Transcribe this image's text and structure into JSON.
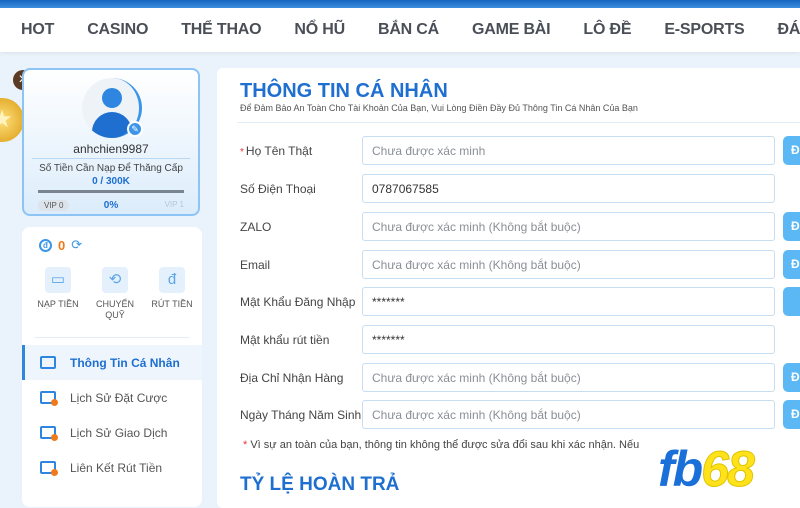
{
  "nav": {
    "items": [
      "HOT",
      "CASINO",
      "THỂ THAO",
      "NỔ HŨ",
      "BẮN CÁ",
      "GAME BÀI",
      "LÔ ĐỀ",
      "E-SPORTS",
      "ĐÁ G"
    ]
  },
  "profile": {
    "username": "anhchien9987",
    "need_label": "Số Tiền Cần Nạp Để Thăng Cấp",
    "amount": "0 / 300K",
    "progress_percent": 0,
    "percent_text": "0%",
    "vip_current": "VIP 0",
    "vip_next": "VIP 1"
  },
  "wallet": {
    "balance": "0",
    "actions": [
      {
        "label": "NẠP TIỀN",
        "icon": "wallet-icon"
      },
      {
        "label": "CHUYỂN QUỸ",
        "icon": "transfer-icon"
      },
      {
        "label": "RÚT TIỀN",
        "icon": "money-bag-icon"
      }
    ]
  },
  "menu": [
    {
      "label": "Thông Tin Cá Nhân",
      "active": true
    },
    {
      "label": "Lịch Sử Đặt Cược"
    },
    {
      "label": "Lịch Sử Giao Dịch"
    },
    {
      "label": "Liên Kết Rút Tiền"
    }
  ],
  "form": {
    "title": "THÔNG TIN CÁ NHÂN",
    "subtitle": "Để Đảm Bảo An Toàn Cho Tài Khoản Của Bạn, Vui Lòng Điền Đầy Đủ Thông Tin Cá Nhân Của Bạn",
    "fields": [
      {
        "label": "Họ Tên Thật",
        "required": true,
        "value": "",
        "placeholder": "Chưa được xác minh",
        "button": "Đ"
      },
      {
        "label": "Số Điện Thoại",
        "value": "0787067585",
        "placeholder": ""
      },
      {
        "label": "ZALO",
        "value": "",
        "placeholder": "Chưa được xác minh (Không bắt buộc)",
        "button": "Đ"
      },
      {
        "label": "Email",
        "value": "",
        "placeholder": "Chưa được xác minh (Không bắt buộc)",
        "button": "Đ"
      },
      {
        "label": "Mật Khẩu Đăng Nhập",
        "value": "*******",
        "placeholder": "",
        "button": ""
      },
      {
        "label": "Mật khẩu rút tiền",
        "value": "*******",
        "placeholder": ""
      },
      {
        "label": "Địa Chỉ Nhận Hàng",
        "value": "",
        "placeholder": "Chưa được xác minh (Không bắt buộc)",
        "button": "Đ"
      },
      {
        "label": "Ngày Tháng Năm Sinh",
        "value": "",
        "placeholder": "Chưa được xác minh (Không bắt buộc)",
        "button": "Đ"
      }
    ],
    "note_star": "*",
    "note": "Vì sự an toàn của bạn, thông tin không thể được sửa đổi sau khi xác nhận. Nếu"
  },
  "section2": {
    "title": "TỶ LỆ HOÀN TRẢ"
  },
  "logo": {
    "text": "fb68",
    "colors": {
      "fb": "#1a6fd8",
      "68": "#ffe21a"
    }
  },
  "colors": {
    "accent": "#1e6fd0",
    "button": "#5cb8f5"
  }
}
